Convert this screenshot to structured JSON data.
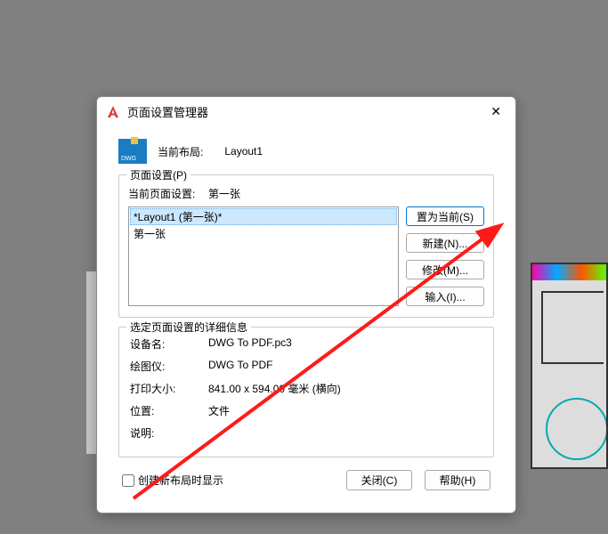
{
  "dialog": {
    "title": "页面设置管理器",
    "dwg_label": "DWG",
    "current_layout_label": "当前布局:",
    "current_layout_name": "Layout1"
  },
  "page_setup": {
    "legend": "页面设置(P)",
    "current_label": "当前页面设置:",
    "current_value": "第一张",
    "items": [
      "*Layout1 (第一张)*",
      "第一张"
    ],
    "buttons": {
      "set_current": "置为当前(S)",
      "new": "新建(N)...",
      "modify": "修改(M)...",
      "import": "输入(I)..."
    }
  },
  "details": {
    "legend": "选定页面设置的详细信息",
    "device_label": "设备名:",
    "device_value": "DWG To PDF.pc3",
    "plotter_label": "绘图仪:",
    "plotter_value": "DWG To PDF",
    "size_label": "打印大小:",
    "size_value": "841.00 x 594.00 毫米 (横向)",
    "location_label": "位置:",
    "location_value": "文件",
    "description_label": "说明:",
    "description_value": ""
  },
  "footer": {
    "checkbox_label": "创建新布局时显示",
    "close": "关闭(C)",
    "help": "帮助(H)"
  }
}
